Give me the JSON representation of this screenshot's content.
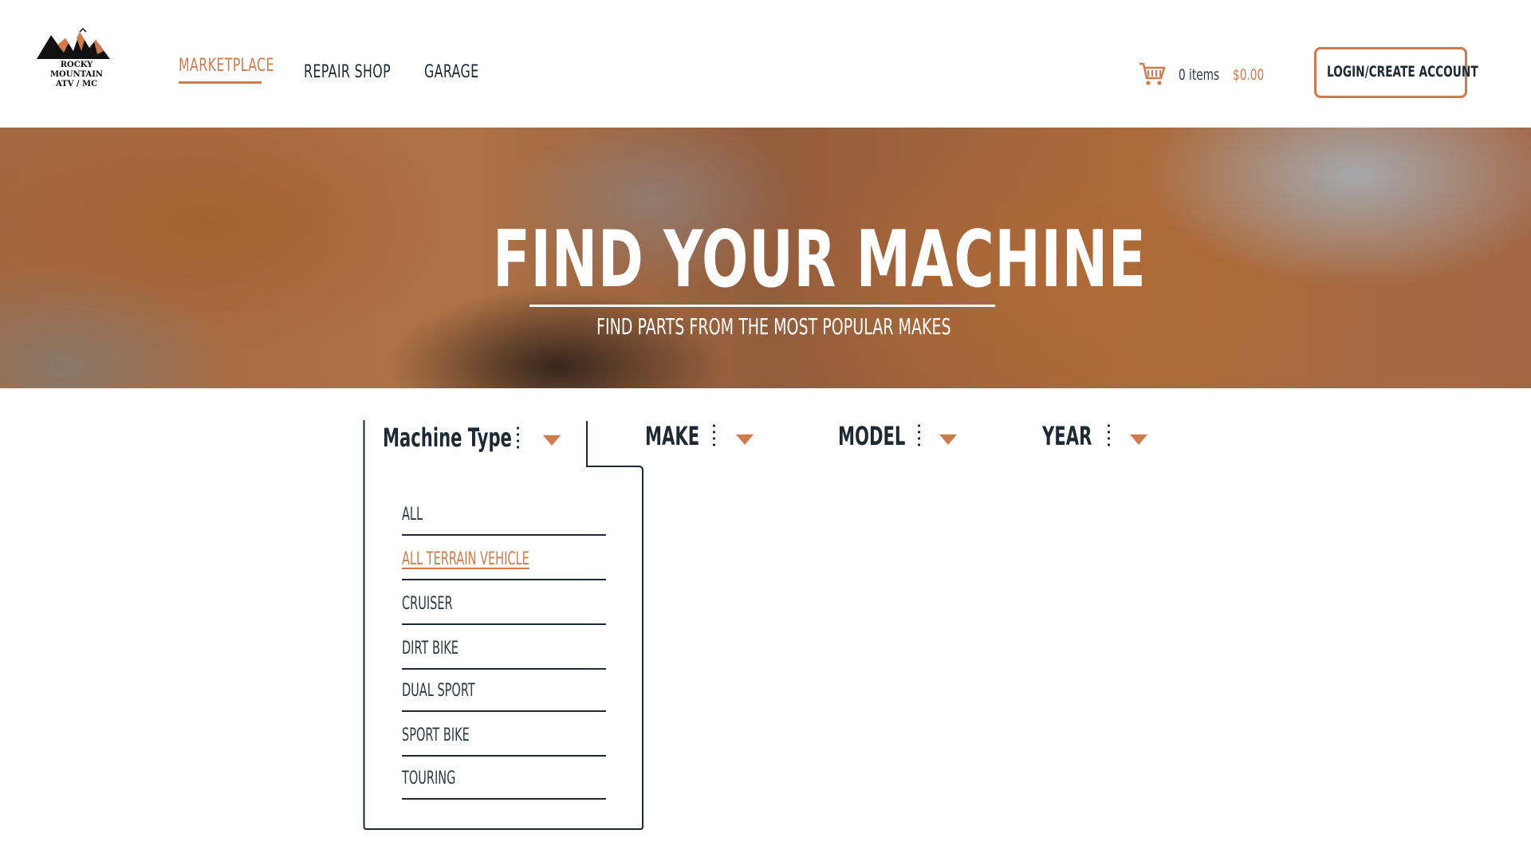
{
  "brand": {
    "line1": "ROCKY MOUNTAIN",
    "line2": "ATV / MC"
  },
  "nav": {
    "items": [
      {
        "label": "MARKETPLACE",
        "active": true
      },
      {
        "label": "REPAIR SHOP",
        "active": false
      },
      {
        "label": "GARAGE",
        "active": false
      }
    ]
  },
  "cart": {
    "items_text": "0 items",
    "total": "$0.00"
  },
  "account": {
    "login_label": "LOGIN/CREATE ACCOUNT"
  },
  "hero": {
    "title": "FIND YOUR MACHINE",
    "subtitle": "FIND PARTS FROM THE MOST POPULAR MAKES"
  },
  "filters": {
    "machine_type": "Machine Type",
    "make": "MAKE",
    "model": "MODEL",
    "year": "YEAR"
  },
  "machine_type_options": [
    {
      "label": "ALL",
      "selected": false
    },
    {
      "label": "ALL TERRAIN VEHICLE",
      "selected": true
    },
    {
      "label": "CRUISER",
      "selected": false
    },
    {
      "label": "DIRT BIKE",
      "selected": false
    },
    {
      "label": "DUAL SPORT",
      "selected": false
    },
    {
      "label": "SPORT BIKE",
      "selected": false
    },
    {
      "label": "TOURING",
      "selected": false
    }
  ],
  "colors": {
    "accent": "#d27a4c",
    "text": "#1e2a33",
    "background": "#ffffff"
  },
  "icons": {
    "cart": "shopping-cart-icon",
    "logo": "mountain-logo-icon",
    "dropdown": "caret-down-icon"
  }
}
